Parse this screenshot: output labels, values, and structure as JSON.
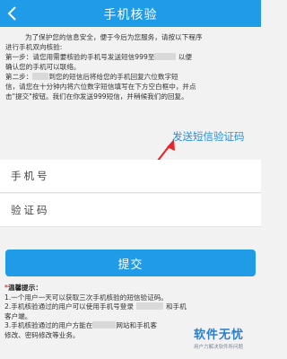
{
  "header": {
    "title": "手机核验"
  },
  "intro": {
    "line1": "为了保护您的信息安全，便于今后为您服务，请按以下程序",
    "line2": "进行手机双向核验:",
    "step1_a": "第一步：请您用需要核验的手机号发送短信999至",
    "step1_b": "以便",
    "step1_c": "确认您的手机可以联络。",
    "step2_a": "第二步：",
    "step2_b": "到您的短信后将给您的手机回复六位数字短",
    "step2_c": "信，请您在十分钟内将六位数字短信填写在下方空白框中，并点",
    "step2_d": "击\"提交\"按钮。我们在你发送999短信，并稍候我们的回复。"
  },
  "send_link": "发送短信验证码",
  "form": {
    "phone_placeholder": "手机号",
    "code_placeholder": "验证码",
    "submit_label": "提交"
  },
  "tips": {
    "title_star": "*",
    "title": "温馨提示：",
    "items": [
      "1.一个用户一天可以获取三次手机核验的短信验证码。",
      "2.手机核验通过的用户可以使用手机号登录",
      "和手机",
      "客户端。",
      "3.手机核验通过的用户方能在",
      "网站和手机客",
      "修改、密码修改等业务。"
    ]
  },
  "watermark": {
    "main": "软件无忧",
    "sub": "用户力解决软件所问题"
  },
  "colors": {
    "primary": "#1f9be8",
    "link": "#2a8fd8",
    "arrow": "#e8252b"
  }
}
